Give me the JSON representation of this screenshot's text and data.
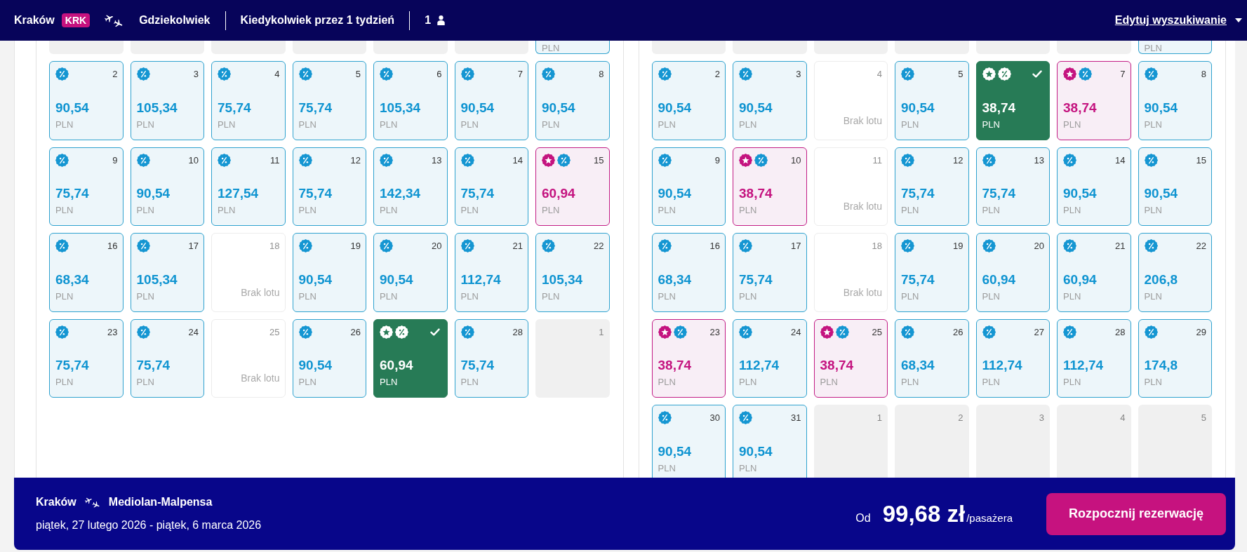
{
  "header": {
    "origin": "Kraków",
    "origin_code": "KRK",
    "destination": "Gdziekolwiek",
    "dates": "Kiedykolwiek przez 1 tydzień",
    "passengers": "1",
    "edit_link": "Edytuj wyszukiwanie"
  },
  "months": [
    {
      "rows": [
        {
          "cut": true,
          "cells": [
            {
              "kind": "outside"
            },
            {
              "kind": "outside"
            },
            {
              "kind": "outside"
            },
            {
              "kind": "outside"
            },
            {
              "kind": "outside"
            },
            {
              "kind": "outside"
            },
            {
              "kind": "fare",
              "currency": "PLN",
              "promo": false,
              "selected": false
            }
          ]
        },
        {
          "cut": false,
          "cells": [
            {
              "kind": "fare",
              "day": "2",
              "price": "90,54",
              "currency": "PLN",
              "discount": true,
              "promo": false,
              "selected": false
            },
            {
              "kind": "fare",
              "day": "3",
              "price": "105,34",
              "currency": "PLN",
              "discount": true,
              "promo": false,
              "selected": false
            },
            {
              "kind": "fare",
              "day": "4",
              "price": "75,74",
              "currency": "PLN",
              "discount": true,
              "promo": false,
              "selected": false
            },
            {
              "kind": "fare",
              "day": "5",
              "price": "75,74",
              "currency": "PLN",
              "discount": true,
              "promo": false,
              "selected": false
            },
            {
              "kind": "fare",
              "day": "6",
              "price": "105,34",
              "currency": "PLN",
              "discount": true,
              "promo": false,
              "selected": false
            },
            {
              "kind": "fare",
              "day": "7",
              "price": "90,54",
              "currency": "PLN",
              "discount": true,
              "promo": false,
              "selected": false
            },
            {
              "kind": "fare",
              "day": "8",
              "price": "90,54",
              "currency": "PLN",
              "discount": true,
              "promo": false,
              "selected": false
            }
          ]
        },
        {
          "cut": false,
          "cells": [
            {
              "kind": "fare",
              "day": "9",
              "price": "75,74",
              "currency": "PLN",
              "discount": true,
              "promo": false,
              "selected": false
            },
            {
              "kind": "fare",
              "day": "10",
              "price": "90,54",
              "currency": "PLN",
              "discount": true,
              "promo": false,
              "selected": false
            },
            {
              "kind": "fare",
              "day": "11",
              "price": "127,54",
              "currency": "PLN",
              "discount": true,
              "promo": false,
              "selected": false
            },
            {
              "kind": "fare",
              "day": "12",
              "price": "75,74",
              "currency": "PLN",
              "discount": true,
              "promo": false,
              "selected": false
            },
            {
              "kind": "fare",
              "day": "13",
              "price": "142,34",
              "currency": "PLN",
              "discount": true,
              "promo": false,
              "selected": false
            },
            {
              "kind": "fare",
              "day": "14",
              "price": "75,74",
              "currency": "PLN",
              "discount": true,
              "promo": false,
              "selected": false
            },
            {
              "kind": "fare",
              "day": "15",
              "price": "60,94",
              "currency": "PLN",
              "discount": true,
              "promo": true,
              "selected": false
            }
          ]
        },
        {
          "cut": false,
          "cells": [
            {
              "kind": "fare",
              "day": "16",
              "price": "68,34",
              "currency": "PLN",
              "discount": true,
              "promo": false,
              "selected": false
            },
            {
              "kind": "fare",
              "day": "17",
              "price": "105,34",
              "currency": "PLN",
              "discount": true,
              "promo": false,
              "selected": false
            },
            {
              "kind": "unavailable",
              "day": "18",
              "note": "Brak lotu"
            },
            {
              "kind": "fare",
              "day": "19",
              "price": "90,54",
              "currency": "PLN",
              "discount": true,
              "promo": false,
              "selected": false
            },
            {
              "kind": "fare",
              "day": "20",
              "price": "90,54",
              "currency": "PLN",
              "discount": true,
              "promo": false,
              "selected": false
            },
            {
              "kind": "fare",
              "day": "21",
              "price": "112,74",
              "currency": "PLN",
              "discount": true,
              "promo": false,
              "selected": false
            },
            {
              "kind": "fare",
              "day": "22",
              "price": "105,34",
              "currency": "PLN",
              "discount": true,
              "promo": false,
              "selected": false
            }
          ]
        },
        {
          "cut": false,
          "cells": [
            {
              "kind": "fare",
              "day": "23",
              "price": "75,74",
              "currency": "PLN",
              "discount": true,
              "promo": false,
              "selected": false
            },
            {
              "kind": "fare",
              "day": "24",
              "price": "75,74",
              "currency": "PLN",
              "discount": true,
              "promo": false,
              "selected": false
            },
            {
              "kind": "unavailable",
              "day": "25",
              "note": "Brak lotu"
            },
            {
              "kind": "fare",
              "day": "26",
              "price": "90,54",
              "currency": "PLN",
              "discount": true,
              "promo": false,
              "selected": false
            },
            {
              "kind": "fare",
              "price": "60,94",
              "currency": "PLN",
              "discount": true,
              "promo": true,
              "selected": true
            },
            {
              "kind": "fare",
              "day": "28",
              "price": "75,74",
              "currency": "PLN",
              "discount": true,
              "promo": false,
              "selected": false
            },
            {
              "kind": "outside",
              "day": "1"
            }
          ]
        }
      ]
    },
    {
      "rows": [
        {
          "cut": true,
          "cells": [
            {
              "kind": "outside"
            },
            {
              "kind": "outside"
            },
            {
              "kind": "outside"
            },
            {
              "kind": "outside"
            },
            {
              "kind": "outside"
            },
            {
              "kind": "outside"
            },
            {
              "kind": "fare",
              "currency": "PLN",
              "promo": false,
              "selected": false
            }
          ]
        },
        {
          "cut": false,
          "cells": [
            {
              "kind": "fare",
              "day": "2",
              "price": "90,54",
              "currency": "PLN",
              "discount": true,
              "promo": false,
              "selected": false
            },
            {
              "kind": "fare",
              "day": "3",
              "price": "90,54",
              "currency": "PLN",
              "discount": true,
              "promo": false,
              "selected": false
            },
            {
              "kind": "unavailable",
              "day": "4",
              "note": "Brak lotu"
            },
            {
              "kind": "fare",
              "day": "5",
              "price": "90,54",
              "currency": "PLN",
              "discount": true,
              "promo": false,
              "selected": false
            },
            {
              "kind": "fare",
              "price": "38,74",
              "currency": "PLN",
              "discount": true,
              "promo": true,
              "selected": true
            },
            {
              "kind": "fare",
              "day": "7",
              "price": "38,74",
              "currency": "PLN",
              "discount": true,
              "promo": true,
              "selected": false
            },
            {
              "kind": "fare",
              "day": "8",
              "price": "90,54",
              "currency": "PLN",
              "discount": true,
              "promo": false,
              "selected": false
            }
          ]
        },
        {
          "cut": false,
          "cells": [
            {
              "kind": "fare",
              "day": "9",
              "price": "90,54",
              "currency": "PLN",
              "discount": true,
              "promo": false,
              "selected": false
            },
            {
              "kind": "fare",
              "day": "10",
              "price": "38,74",
              "currency": "PLN",
              "discount": true,
              "promo": true,
              "selected": false
            },
            {
              "kind": "unavailable",
              "day": "11",
              "note": "Brak lotu"
            },
            {
              "kind": "fare",
              "day": "12",
              "price": "75,74",
              "currency": "PLN",
              "discount": true,
              "promo": false,
              "selected": false
            },
            {
              "kind": "fare",
              "day": "13",
              "price": "75,74",
              "currency": "PLN",
              "discount": true,
              "promo": false,
              "selected": false
            },
            {
              "kind": "fare",
              "day": "14",
              "price": "90,54",
              "currency": "PLN",
              "discount": true,
              "promo": false,
              "selected": false
            },
            {
              "kind": "fare",
              "day": "15",
              "price": "90,54",
              "currency": "PLN",
              "discount": true,
              "promo": false,
              "selected": false
            }
          ]
        },
        {
          "cut": false,
          "cells": [
            {
              "kind": "fare",
              "day": "16",
              "price": "68,34",
              "currency": "PLN",
              "discount": true,
              "promo": false,
              "selected": false
            },
            {
              "kind": "fare",
              "day": "17",
              "price": "75,74",
              "currency": "PLN",
              "discount": true,
              "promo": false,
              "selected": false
            },
            {
              "kind": "unavailable",
              "day": "18",
              "note": "Brak lotu"
            },
            {
              "kind": "fare",
              "day": "19",
              "price": "75,74",
              "currency": "PLN",
              "discount": true,
              "promo": false,
              "selected": false
            },
            {
              "kind": "fare",
              "day": "20",
              "price": "60,94",
              "currency": "PLN",
              "discount": true,
              "promo": false,
              "selected": false
            },
            {
              "kind": "fare",
              "day": "21",
              "price": "60,94",
              "currency": "PLN",
              "discount": true,
              "promo": false,
              "selected": false
            },
            {
              "kind": "fare",
              "day": "22",
              "price": "206,8",
              "currency": "PLN",
              "discount": true,
              "promo": false,
              "selected": false
            }
          ]
        },
        {
          "cut": false,
          "cells": [
            {
              "kind": "fare",
              "day": "23",
              "price": "38,74",
              "currency": "PLN",
              "discount": true,
              "promo": true,
              "selected": false
            },
            {
              "kind": "fare",
              "day": "24",
              "price": "112,74",
              "currency": "PLN",
              "discount": true,
              "promo": false,
              "selected": false
            },
            {
              "kind": "fare",
              "day": "25",
              "price": "38,74",
              "currency": "PLN",
              "discount": true,
              "promo": true,
              "selected": false
            },
            {
              "kind": "fare",
              "day": "26",
              "price": "68,34",
              "currency": "PLN",
              "discount": true,
              "promo": false,
              "selected": false
            },
            {
              "kind": "fare",
              "day": "27",
              "price": "112,74",
              "currency": "PLN",
              "discount": true,
              "promo": false,
              "selected": false
            },
            {
              "kind": "fare",
              "day": "28",
              "price": "112,74",
              "currency": "PLN",
              "discount": true,
              "promo": false,
              "selected": false
            },
            {
              "kind": "fare",
              "day": "29",
              "price": "174,8",
              "currency": "PLN",
              "discount": true,
              "promo": false,
              "selected": false
            }
          ]
        },
        {
          "cut": false,
          "cells": [
            {
              "kind": "fare",
              "day": "30",
              "price": "90,54",
              "currency": "PLN",
              "discount": true,
              "promo": false,
              "selected": false
            },
            {
              "kind": "fare",
              "day": "31",
              "price": "90,54",
              "currency": "PLN",
              "discount": true,
              "promo": false,
              "selected": false
            },
            {
              "kind": "outside",
              "day": "1"
            },
            {
              "kind": "outside",
              "day": "2"
            },
            {
              "kind": "outside",
              "day": "3"
            },
            {
              "kind": "outside",
              "day": "4"
            },
            {
              "kind": "outside",
              "day": "5"
            }
          ]
        }
      ]
    }
  ],
  "summary": {
    "origin": "Kraków",
    "destination": "Mediolan-Malpensa",
    "dates": "piątek, 27 lutego 2026 - piątek, 6 marca 2026",
    "price_prefix": "Od",
    "price": "99,68 zł",
    "price_suffix": "/pasażera",
    "button": "Rozpocznij rezerwację"
  }
}
